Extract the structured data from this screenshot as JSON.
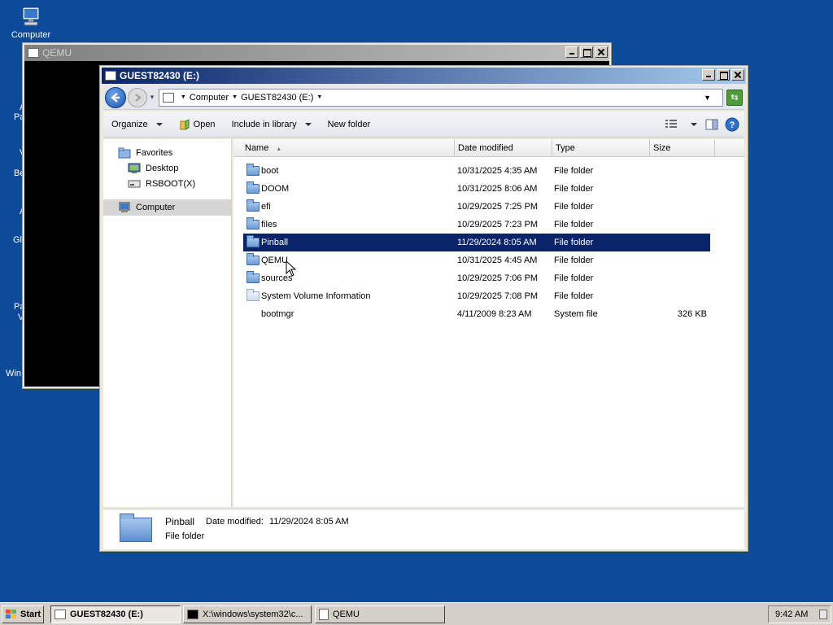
{
  "desktop": {
    "icons": [
      {
        "label": "Computer",
        "icon": "computer-icon"
      }
    ],
    "partial_labels": [
      "A",
      "Pa",
      "V",
      "Be",
      "A",
      "Gl",
      "Pa",
      "V",
      "Win"
    ]
  },
  "qemu_window": {
    "title": "QEMU"
  },
  "explorer": {
    "title": "GUEST82430 (E:)",
    "address": {
      "segments": [
        "Computer",
        "GUEST82430 (E:)"
      ]
    },
    "toolbar": {
      "organize": "Organize",
      "open": "Open",
      "include_in_library": "Include in library",
      "new_folder": "New folder"
    },
    "nav": {
      "favorites": "Favorites",
      "desktop": "Desktop",
      "rsboot": "RSBOOT(X)",
      "computer": "Computer"
    },
    "columns": {
      "name": "Name",
      "date_modified": "Date modified",
      "type": "Type",
      "size": "Size"
    },
    "files": [
      {
        "name": "boot",
        "date": "10/31/2025 4:35 AM",
        "type": "File folder",
        "size": "",
        "icon": "folder-icon"
      },
      {
        "name": "DOOM",
        "date": "10/31/2025 8:06 AM",
        "type": "File folder",
        "size": "",
        "icon": "folder-icon"
      },
      {
        "name": "efi",
        "date": "10/29/2025 7:25 PM",
        "type": "File folder",
        "size": "",
        "icon": "folder-icon"
      },
      {
        "name": "files",
        "date": "10/29/2025 7:23 PM",
        "type": "File folder",
        "size": "",
        "icon": "folder-icon"
      },
      {
        "name": "Pinball",
        "date": "11/29/2024 8:05 AM",
        "type": "File folder",
        "size": "",
        "icon": "folder-icon",
        "selected": true
      },
      {
        "name": "QEMU",
        "date": "10/31/2025 4:45 AM",
        "type": "File folder",
        "size": "",
        "icon": "folder-icon"
      },
      {
        "name": "sources",
        "date": "10/29/2025 7:06 PM",
        "type": "File folder",
        "size": "",
        "icon": "folder-icon"
      },
      {
        "name": "System Volume Information",
        "date": "10/29/2025 7:08 PM",
        "type": "File folder",
        "size": "",
        "icon": "system-folder-icon"
      },
      {
        "name": "bootmgr",
        "date": "4/11/2009 8:23 AM",
        "type": "System file",
        "size": "326 KB",
        "icon": "file-icon"
      }
    ],
    "details": {
      "name": "Pinball",
      "date_label": "Date modified:",
      "date_value": "11/29/2024 8:05 AM",
      "type": "File folder"
    }
  },
  "taskbar": {
    "start": "Start",
    "tasks": [
      "GUEST82430 (E:)",
      "X:\\windows\\system32\\c...",
      "QEMU"
    ],
    "clock": "9:42 AM"
  },
  "colors": {
    "desktop": "#0e4a9a",
    "selection": "#0a246a",
    "title_active": "#0a246a"
  }
}
